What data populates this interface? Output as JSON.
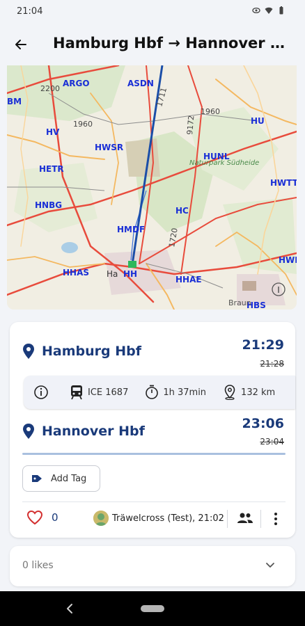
{
  "status_bar": {
    "time": "21:04"
  },
  "app_bar": {
    "title": "Hamburg Hbf → Hannover Hbf"
  },
  "map": {
    "labels": [
      "ARGO",
      "ASDN",
      "BM",
      "HV",
      "HWSR",
      "HU",
      "HUNL",
      "HETR",
      "HWTT",
      "HNBG",
      "HC",
      "HMDF",
      "HHAS",
      "HH",
      "HHAE",
      "HWD",
      "HBS",
      "Ha"
    ],
    "route_color": "#1b4ea8",
    "line_numbers": [
      "2200",
      "1960",
      "1960",
      "1720",
      "9172",
      "1711"
    ],
    "place_names": [
      "Naturpark Südheide",
      "Braun"
    ]
  },
  "checkin": {
    "origin": {
      "name": "Hamburg Hbf",
      "time": "21:29",
      "planned": "21:28"
    },
    "destination": {
      "name": "Hannover Hbf",
      "time": "23:06",
      "planned": "23:04"
    },
    "info": {
      "train": "ICE 1687",
      "duration": "1h 37min",
      "distance": "132 km"
    },
    "progress": 1.0,
    "add_tag_label": "Add Tag",
    "likes": "0",
    "user": "Träwelcross (Test), 21:02"
  },
  "likes_panel": {
    "label": "0 likes"
  },
  "colors": {
    "accent": "#1a3a7a",
    "like": "#d32f2f",
    "background": "#f2f4f8"
  }
}
